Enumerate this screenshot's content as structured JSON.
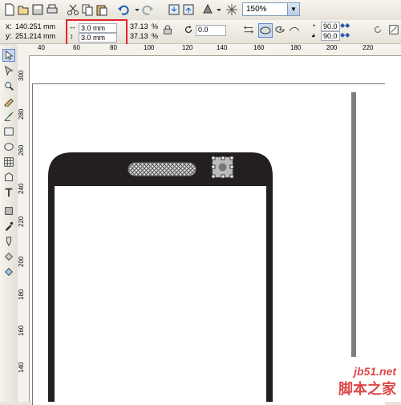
{
  "toolbar": {
    "zoom_value": "150%"
  },
  "property_bar": {
    "x_label": "x:",
    "x_value": "140.251 mm",
    "y_label": "y:",
    "y_value": "251.214 mm",
    "width_value": "3.0 mm",
    "height_value": "3.0 mm",
    "scale_x_value": "37.13",
    "scale_y_value": "37.13",
    "percent_x": "%",
    "percent_y": "%",
    "rotation_value": "0.0",
    "start_angle_value": "90.0",
    "end_angle_value": "90.0"
  },
  "ruler": {
    "horizontal_numbers": [
      "40",
      "60",
      "80",
      "100",
      "120",
      "140",
      "160",
      "180",
      "200",
      "220"
    ],
    "vertical_numbers": [
      "300",
      "280",
      "260",
      "240",
      "220",
      "200",
      "180",
      "160",
      "140"
    ]
  },
  "watermark": {
    "url": "jb51.net",
    "text": "脚本之家"
  },
  "colors": {
    "highlight_box": "#e0262b",
    "phone_body": "#231f20"
  }
}
